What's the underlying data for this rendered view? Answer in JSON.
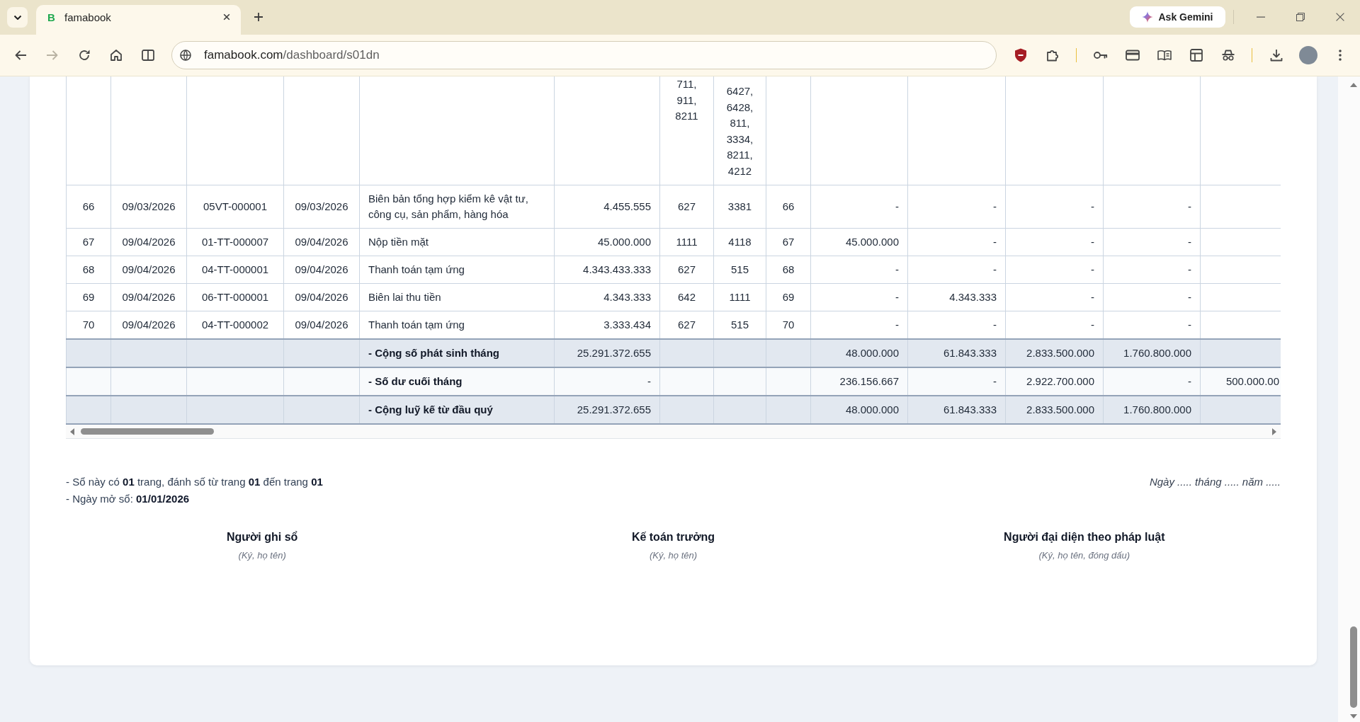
{
  "browser": {
    "tab": {
      "favicon": "B",
      "title": "famabook"
    },
    "assistant_button": "Ask Gemini",
    "toolbar": {
      "forward_disabled": true
    },
    "address": {
      "host": "famabook.com",
      "path": "/dashboard/s01dn"
    }
  },
  "table": {
    "cut_row": {
      "column_7": "711, 911, 8211",
      "column_8": "6427, 6428, 811, 3334, 8211, 4212"
    },
    "rows": [
      {
        "kind": "entry",
        "cells": [
          "66",
          "09/03/2026",
          "05VT-000001",
          "09/03/2026",
          "Biên bản tổng hợp kiểm kê vật tư, công cụ, sản phẩm, hàng hóa",
          "4.455.555",
          "627",
          "3381",
          "66",
          "-",
          "-",
          "-",
          "-"
        ]
      },
      {
        "kind": "entry",
        "cells": [
          "67",
          "09/04/2026",
          "01-TT-000007",
          "09/04/2026",
          "Nộp tiền mặt",
          "45.000.000",
          "1111",
          "4118",
          "67",
          "45.000.000",
          "-",
          "-",
          "-"
        ]
      },
      {
        "kind": "entry",
        "cells": [
          "68",
          "09/04/2026",
          "04-TT-000001",
          "09/04/2026",
          "Thanh toán tạm ứng",
          "4.343.433.333",
          "627",
          "515",
          "68",
          "-",
          "-",
          "-",
          "-"
        ]
      },
      {
        "kind": "entry",
        "cells": [
          "69",
          "09/04/2026",
          "06-TT-000001",
          "09/04/2026",
          "Biên lai thu tiền",
          "4.343.333",
          "642",
          "1111",
          "69",
          "-",
          "4.343.333",
          "-",
          "-"
        ]
      },
      {
        "kind": "entry",
        "cells": [
          "70",
          "09/04/2026",
          "04-TT-000002",
          "09/04/2026",
          "Thanh toán tạm ứng",
          "3.333.434",
          "627",
          "515",
          "70",
          "-",
          "-",
          "-",
          "-"
        ]
      },
      {
        "kind": "total",
        "label": "- Cộng số phát sinh tháng",
        "amount": "25.291.372.655",
        "values": [
          "48.000.000",
          "61.843.333",
          "2.833.500.000",
          "1.760.800.000"
        ]
      },
      {
        "kind": "balance",
        "label": "- Số dư cuối tháng",
        "amount": "-",
        "values": [
          "236.156.667",
          "-",
          "2.922.700.000",
          "-",
          "500.000.00"
        ]
      },
      {
        "kind": "total",
        "label": "- Cộng luỹ kế từ đầu quý",
        "amount": "25.291.372.655",
        "values": [
          "48.000.000",
          "61.843.333",
          "2.833.500.000",
          "1.760.800.000"
        ]
      }
    ]
  },
  "footer": {
    "notes": [
      "- Sổ này có **01** trang, đánh số từ trang **01** đến trang **01**",
      "- Ngày mở sổ: **01/01/2026**"
    ],
    "date_line": "Ngày ..... tháng ..... năm .....",
    "signatures": [
      {
        "title": "Người ghi sổ",
        "hint": "(Ký, họ tên)"
      },
      {
        "title": "Kế toán trưởng",
        "hint": "(Ký, họ tên)"
      },
      {
        "title": "Người đại diện theo pháp luật",
        "hint": "(Ký, họ tên, đóng dấu)"
      }
    ]
  }
}
